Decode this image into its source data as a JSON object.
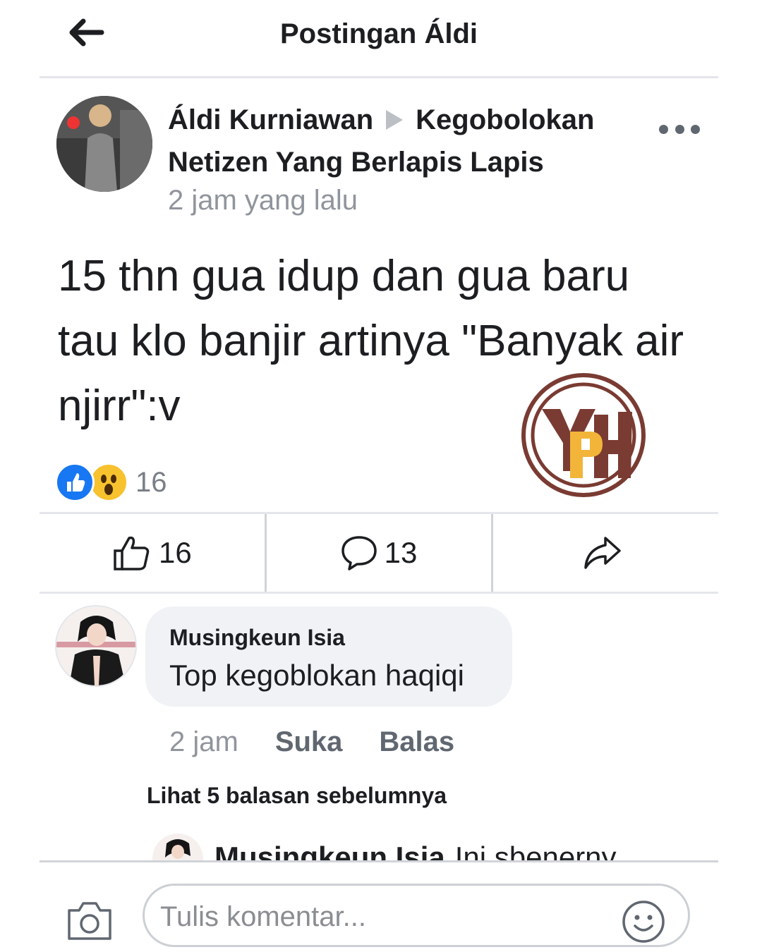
{
  "header": {
    "title": "Postingan Áldi"
  },
  "post": {
    "author": "Áldi Kurniawan",
    "target": "Kegobolokan Netizen Yang Berlapis Lapis",
    "time": "2 jam yang lalu",
    "text": "15 thn gua idup dan gua baru tau klo banjir artinya \"Banyak air njirr\":v",
    "reaction_count": "16"
  },
  "actions": {
    "like_count": "16",
    "comment_count": "13"
  },
  "comment": {
    "name": "Musingkeun Isia",
    "text": "Top kegoblokan haqiqi",
    "time": "2 jam",
    "like_label": "Suka",
    "reply_label": "Balas",
    "more_replies": "Lihat 5 balasan sebelumnya"
  },
  "reply_preview": {
    "name": "Musingkeun Isia",
    "text": "Ini sbenerny"
  },
  "composer": {
    "placeholder": "Tulis komentar..."
  },
  "colors": {
    "like_blue": "#1877f2",
    "wow_yellow": "#f7c22e",
    "watermark_brown": "#7a3b32",
    "watermark_yellow": "#f2b53a"
  }
}
